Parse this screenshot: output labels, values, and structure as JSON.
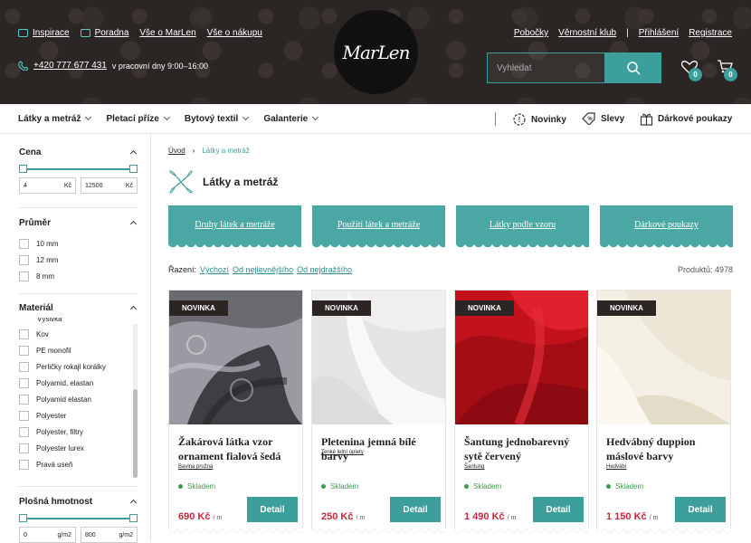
{
  "header": {
    "top_links": [
      "Inspirace",
      "Poradna",
      "Vše o MarLen",
      "Vše o nákupu"
    ],
    "phone": "+420 777 677 431",
    "hours": "v pracovní dny 9:00–16:00",
    "logo_text": "MarLen",
    "right_links": [
      "Pobočky",
      "Věrnostní klub",
      "Přihlášení",
      "Registrace"
    ],
    "separator": "|",
    "search_placeholder": "Vyhledat",
    "wishlist_count": "0",
    "cart_count": "0"
  },
  "nav": {
    "items": [
      "Látky a metráž",
      "Pletací příze",
      "Bytový textil",
      "Galanterie"
    ],
    "right_items": [
      "Novinky",
      "Slevy",
      "Dárkové poukazy"
    ]
  },
  "sidebar": {
    "price": {
      "title": "Cena",
      "min": "4",
      "max": "12500",
      "unit": "Kč"
    },
    "diameter": {
      "title": "Průměr",
      "options": [
        "10 mm",
        "12 mm",
        "8 mm"
      ]
    },
    "material": {
      "title": "Materiál",
      "partial": "Výšivka",
      "options": [
        "Kov",
        "PE monofil",
        "Perličky rokajl korálky",
        "Polyamid, elastan",
        "Polyamid elastan",
        "Polyester",
        "Polyester, filtry",
        "Polyester lurex",
        "Pravá useň"
      ]
    },
    "weight": {
      "title": "Plošná hmotnost",
      "min": "0",
      "max": "800",
      "unit": "g/m2"
    }
  },
  "main": {
    "breadcrumb": [
      "Úvod",
      "Látky a metráž"
    ],
    "title": "Látky a metráž",
    "categories": [
      "Druhy látek a metráže",
      "Použití látek a metráže",
      "Látky podle vzoru",
      "Dárkové poukazy"
    ],
    "sort_label": "Řazení:",
    "sort_options": [
      "Výchozí",
      "Od nejlevnějšího",
      "Od nejdražšího"
    ],
    "count_label": "Produktů: 4978"
  },
  "products": [
    {
      "badge": "NOVINKA",
      "name": "Žakárová látka vzor ornament fialová šedá",
      "sub": "Bavlna pružná",
      "stock": "Skladem",
      "price": "690 Kč",
      "unit": "/ m",
      "button": "Detail"
    },
    {
      "badge": "NOVINKA",
      "name": "Pletenina jemná bílé barvy",
      "sub": "Tenké letní úplety",
      "stock": "Skladem",
      "price": "250 Kč",
      "unit": "/ m",
      "button": "Detail"
    },
    {
      "badge": "NOVINKA",
      "name": "Šantung jednobarevný sytě červený",
      "sub": "Šantung",
      "stock": "Skladem",
      "price": "1 490 Kč",
      "unit": "/ m",
      "button": "Detail"
    },
    {
      "badge": "NOVINKA",
      "name": "Hedvábný duppion máslové barvy",
      "sub": "Hedvábí",
      "stock": "Skladem",
      "price": "1 150 Kč",
      "unit": "/ m",
      "button": "Detail"
    }
  ],
  "colors": {
    "accent": "#3d9f9b",
    "price": "#c7293c",
    "header_bg": "#2b2624"
  }
}
